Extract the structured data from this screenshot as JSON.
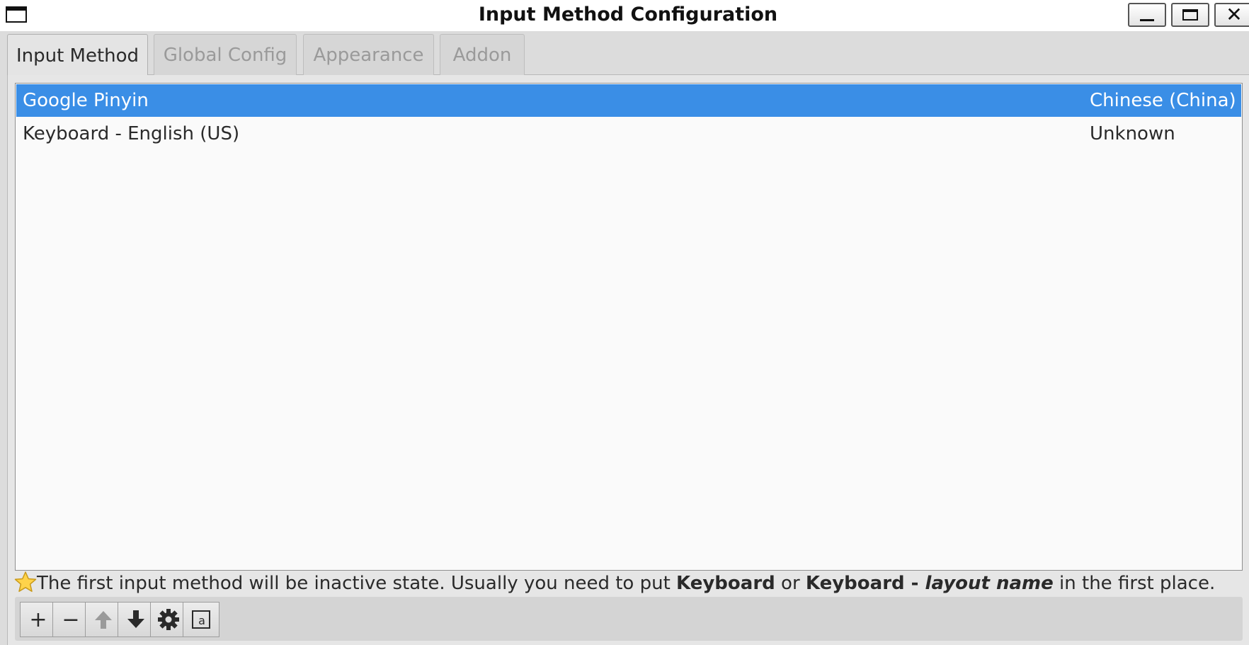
{
  "window": {
    "title": "Input Method Configuration"
  },
  "tabs": [
    {
      "label": "Input Method",
      "active": true
    },
    {
      "label": "Global Config",
      "active": false
    },
    {
      "label": "Appearance",
      "active": false
    },
    {
      "label": "Addon",
      "active": false
    }
  ],
  "input_methods": [
    {
      "name": "Google Pinyin",
      "language": "Chinese (China)",
      "selected": true
    },
    {
      "name": "Keyboard - English (US)",
      "language": "Unknown",
      "selected": false
    }
  ],
  "hint": {
    "part1": "The first input method will be inactive state. Usually you need to put ",
    "bold1": "Keyboard",
    "part2": " or ",
    "bold2": "Keyboard - ",
    "bold_italic": "layout name",
    "part3": " in the first place."
  },
  "toolbar": {
    "add": "+",
    "remove": "−"
  },
  "icons": {
    "window": "window-icon",
    "add": "plus-icon",
    "remove": "minus-icon",
    "move_up": "arrow-up-icon",
    "move_down": "arrow-down-icon",
    "configure": "gear-icon",
    "keyboard_layout": "keyboard-layout-icon",
    "hint": "star-icon"
  },
  "colors": {
    "selection": "#3a8ee6",
    "background": "#dcdcdc"
  }
}
